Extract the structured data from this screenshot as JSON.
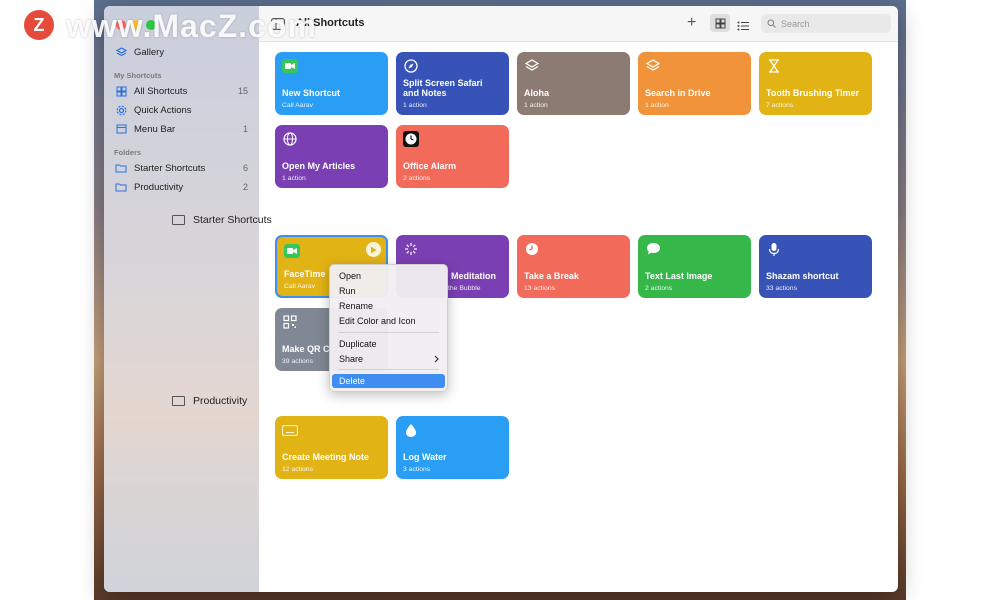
{
  "watermark": {
    "logo_letter": "Z",
    "text": "www.MacZ.com"
  },
  "toolbar": {
    "title": "All Shortcuts",
    "search_placeholder": "Search",
    "icons": [
      "sidebar-toggle-icon",
      "plus-icon",
      "grid-view-icon",
      "list-view-icon",
      "search-icon"
    ]
  },
  "sidebar": {
    "gallery": "Gallery",
    "my_shortcuts_header": "My Shortcuts",
    "items": [
      {
        "label": "All Shortcuts",
        "count": "15",
        "icon": "grid-icon"
      },
      {
        "label": "Quick Actions",
        "count": "",
        "icon": "gear-icon"
      },
      {
        "label": "Menu Bar",
        "count": "1",
        "icon": "menubar-icon"
      }
    ],
    "folders_header": "Folders",
    "folders": [
      {
        "label": "Starter Shortcuts",
        "count": "6",
        "icon": "folder-icon"
      },
      {
        "label": "Productivity",
        "count": "2",
        "icon": "folder-icon"
      }
    ]
  },
  "tiles_top": [
    {
      "name": "New Shortcut",
      "sub": "Call Aarav",
      "color": "#2a9df4",
      "icon": "facetime-icon"
    },
    {
      "name": "Split Screen Safari and Notes",
      "sub": "1 action",
      "color": "#3753b8",
      "icon": "compass-icon"
    },
    {
      "name": "Aloha",
      "sub": "1 action",
      "color": "#8c7b73",
      "icon": "layers-icon"
    },
    {
      "name": "Search in Drive",
      "sub": "1 action",
      "color": "#f0933a",
      "icon": "layers-icon"
    },
    {
      "name": "Tooth Brushing Timer",
      "sub": "7 actions",
      "color": "#e2b314",
      "icon": "hourglass-icon"
    },
    {
      "name": "Open My Articles",
      "sub": "1 action",
      "color": "#7b3fb4",
      "icon": "globe-icon"
    },
    {
      "name": "Office Alarm",
      "sub": "2 actions",
      "color": "#f26a5a",
      "icon": "clock-icon"
    }
  ],
  "section_starter": "Starter Shortcuts",
  "tiles_starter": [
    {
      "name": "FaceTime",
      "sub": "Call Aarav",
      "color": "#e2b314",
      "icon": "facetime-icon"
    },
    {
      "name": "Meditation",
      "sub": "the Bubble",
      "color": "#7b3fb4",
      "icon": "sparkle-icon"
    },
    {
      "name": "Take a Break",
      "sub": "13 actions",
      "color": "#f26a5a",
      "icon": "clock-icon"
    },
    {
      "name": "Text Last Image",
      "sub": "2 actions",
      "color": "#35b74a",
      "icon": "message-icon"
    },
    {
      "name": "Shazam shortcut",
      "sub": "33 actions",
      "color": "#3753b8",
      "icon": "microphone-icon"
    },
    {
      "name": "Make QR C",
      "sub": "39 actions",
      "color": "#7f8894",
      "icon": "qr-icon"
    }
  ],
  "section_productivity": "Productivity",
  "tiles_productivity": [
    {
      "name": "Create Meeting Note",
      "sub": "12 actions",
      "color": "#e2b314",
      "icon": "keyboard-icon"
    },
    {
      "name": "Log Water",
      "sub": "3 actions",
      "color": "#2a9df4",
      "icon": "drop-icon"
    }
  ],
  "context_menu": {
    "items": [
      "Open",
      "Run",
      "Rename",
      "Edit Color and Icon",
      "Duplicate",
      "Share",
      "Delete"
    ],
    "selected": "Delete",
    "accent": "#3e8df2"
  }
}
